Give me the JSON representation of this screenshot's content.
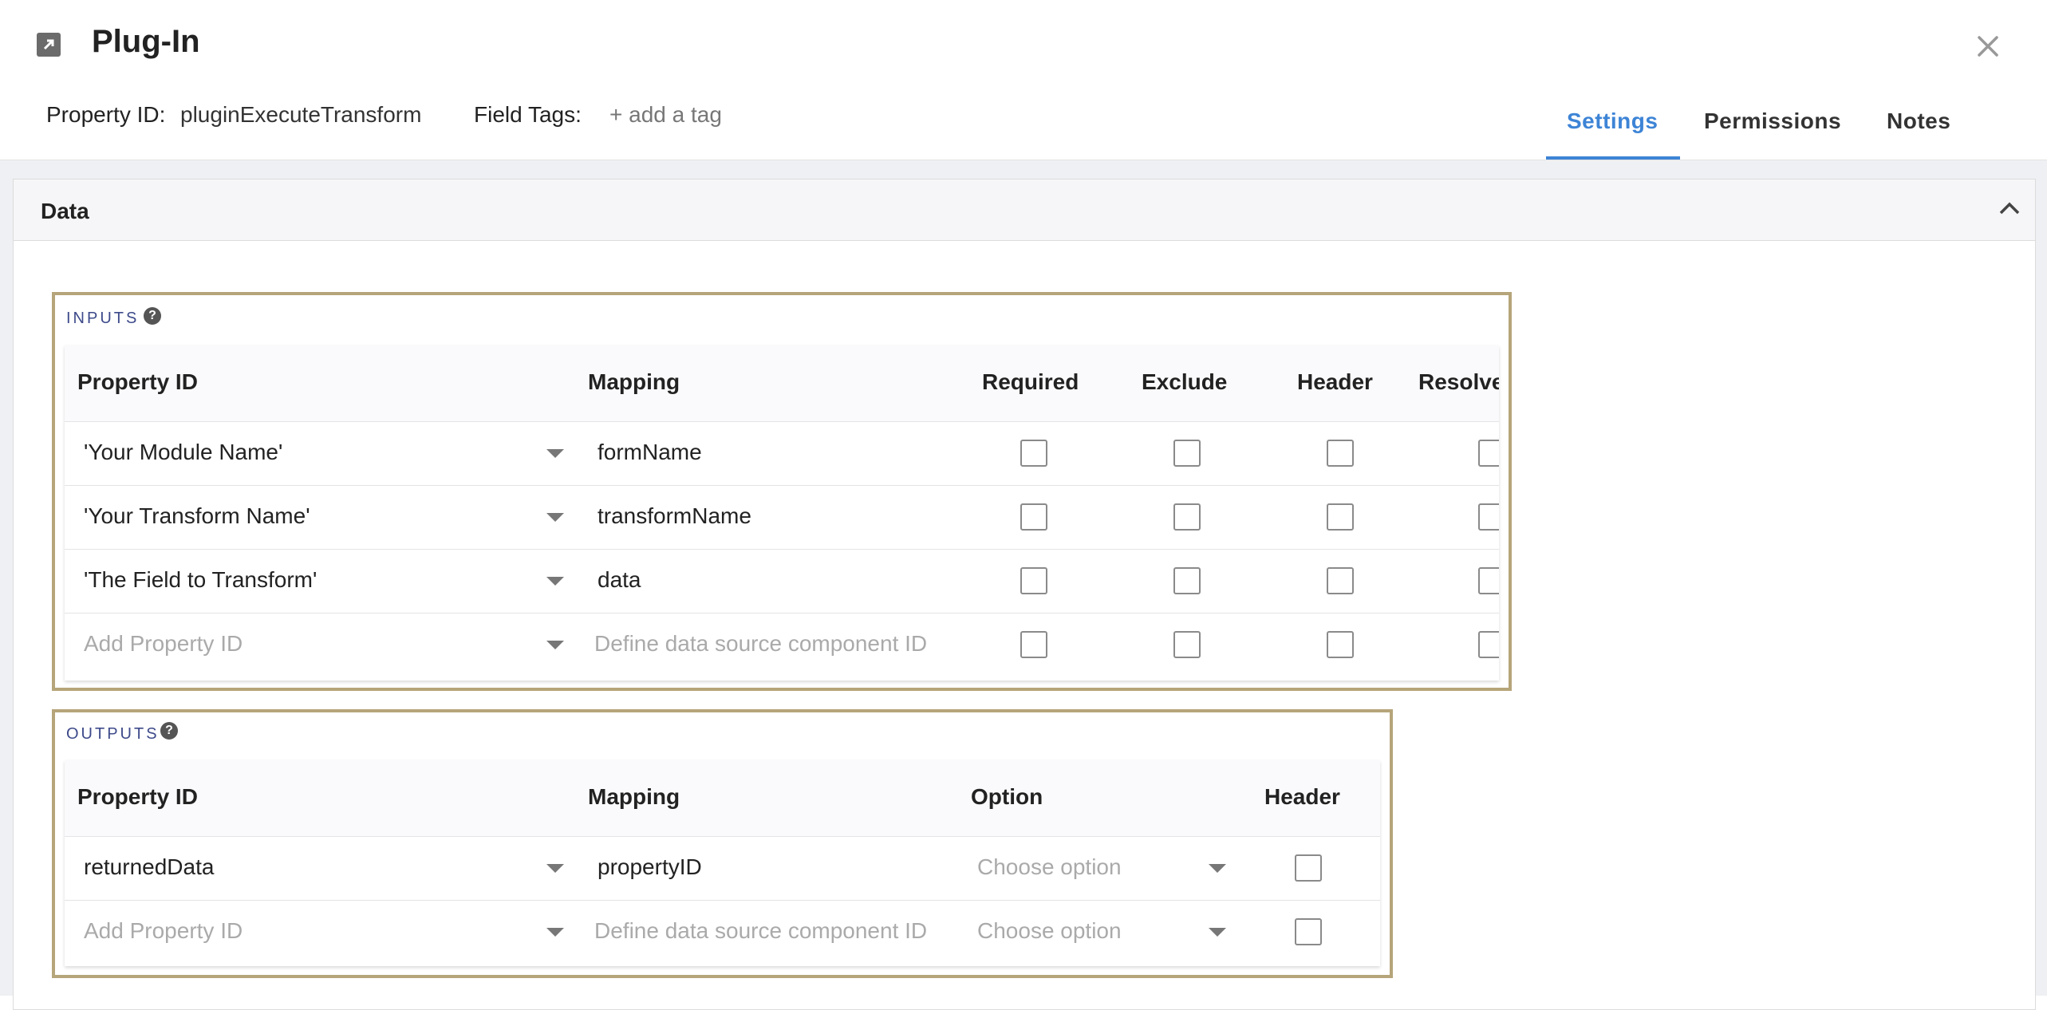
{
  "header": {
    "title": "Plug-In",
    "property_id_label": "Property ID:",
    "property_id_value": "pluginExecuteTransform",
    "field_tags_label": "Field Tags:",
    "add_tag_label": "+ add a tag",
    "tabs": [
      {
        "label": "Settings",
        "active": true
      },
      {
        "label": "Permissions",
        "active": false
      },
      {
        "label": "Notes",
        "active": false
      }
    ]
  },
  "panel": {
    "title": "Data"
  },
  "inputs": {
    "label": "INPUTS",
    "columns": [
      "Property ID",
      "Mapping",
      "Required",
      "Exclude",
      "Header",
      "Resolve"
    ],
    "rows": [
      {
        "property_id": "'Your Module Name'",
        "mapping": "formName",
        "required": false,
        "exclude": false,
        "header": false,
        "resolve": false
      },
      {
        "property_id": "'Your Transform Name'",
        "mapping": "transformName",
        "required": false,
        "exclude": false,
        "header": false,
        "resolve": false
      },
      {
        "property_id": "'The Field to Transform'",
        "mapping": "data",
        "required": false,
        "exclude": false,
        "header": false,
        "resolve": false
      }
    ],
    "new_row": {
      "property_placeholder": "Add Property ID",
      "mapping_placeholder": "Define data source component ID"
    }
  },
  "outputs": {
    "label": "OUTPUTS",
    "columns": [
      "Property ID",
      "Mapping",
      "Option",
      "Header"
    ],
    "rows": [
      {
        "property_id": "returnedData",
        "mapping": "propertyID",
        "option_placeholder": "Choose option",
        "header": false
      }
    ],
    "new_row": {
      "property_placeholder": "Add Property ID",
      "mapping_placeholder": "Define data source component ID",
      "option_placeholder": "Choose option"
    }
  },
  "colors": {
    "accent": "#3d84d6",
    "frame": "#b6a57a",
    "section_label": "#3d4a8a"
  }
}
